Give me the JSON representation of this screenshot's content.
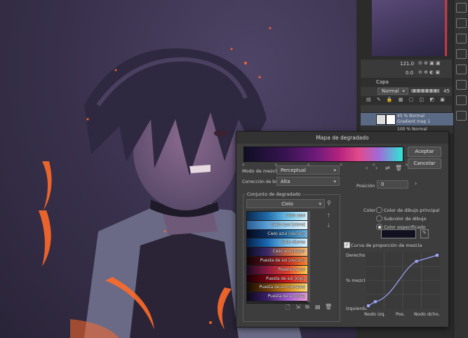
{
  "panel": {
    "zoom": "121.0",
    "rotate": "0.0",
    "tab": "Capa",
    "blend_mode": "Normal",
    "opacity": "45",
    "layers": [
      {
        "line1": "45 % Normal",
        "line2": "Gradient map 1"
      },
      {
        "line1": "100 % Normal",
        "line2": ""
      }
    ]
  },
  "dialog": {
    "title": "Mapa de degradado",
    "accept_label": "Aceptar",
    "cancel_label": "Cancelar",
    "blend_label": "Modo de mezcla",
    "blend_value": "Perceptual",
    "brightness_label": "Corrección de brillo",
    "brightness_value": "Alta",
    "position_label": "Posición",
    "position_value": "0",
    "set_label": "Conjunto de degradado",
    "set_value": "Cielo",
    "gradients": [
      {
        "name": "Cielo azul",
        "colors": [
          "#0c2a4f",
          "#1e6aa8",
          "#6ec3ea",
          "#d8f2fa"
        ]
      },
      {
        "name": "Cielo azul [claro]",
        "colors": [
          "#2a5c92",
          "#5a9fd6",
          "#a6d8f2",
          "#eefaff"
        ]
      },
      {
        "name": "Cielo azul [oscuro]",
        "colors": [
          "#040a1c",
          "#0e2c5c",
          "#1f6aa8",
          "#6fb8e4"
        ]
      },
      {
        "name": "Cielo diurno",
        "colors": [
          "#05224a",
          "#1a68b4",
          "#7fc4ec",
          "#e0f4fb"
        ]
      },
      {
        "name": "Cielo anochecer",
        "colors": [
          "#0a0a1e",
          "#3a2a6a",
          "#d0683e",
          "#f6c27a"
        ]
      },
      {
        "name": "Puesta de sol [oscuro]",
        "colors": [
          "#120306",
          "#58101a",
          "#c4281c",
          "#ff8a2e"
        ]
      },
      {
        "name": "Puesta de sol",
        "colors": [
          "#1c0820",
          "#8a1a40",
          "#e4402a",
          "#ffd04a"
        ]
      },
      {
        "name": "Puesta de sol [rojo]",
        "colors": [
          "#1a0004",
          "#700010",
          "#d01818",
          "#ff6a3a"
        ]
      },
      {
        "name": "Puesta de sol [dorado]",
        "colors": [
          "#140a02",
          "#6a3a08",
          "#d48a1a",
          "#ffe07a"
        ]
      },
      {
        "name": "Puesta de sol [lila]",
        "colors": [
          "#0c0818",
          "#3a1e6a",
          "#a05ad0",
          "#f0a0d8"
        ]
      }
    ],
    "color_label": "Color:",
    "color_options": [
      "Color de dibujo principal",
      "Subcolor de dibujo",
      "Color especificado"
    ],
    "selected_color_option": 2,
    "specified_color": "#111122",
    "curve_check_label": "Curva de proporción de mezcla",
    "curve_left_labels": [
      "Derecho",
      "% mezcla",
      "Izquierdo"
    ],
    "curve_bottom_labels": [
      "Nodo izq.",
      "Pos.",
      "Nodo dcho."
    ],
    "curve_points": [
      [
        0,
        0
      ],
      [
        0.1,
        0.08
      ],
      [
        0.7,
        0.88
      ],
      [
        1,
        1
      ]
    ]
  },
  "accent": "#9ea8ff"
}
